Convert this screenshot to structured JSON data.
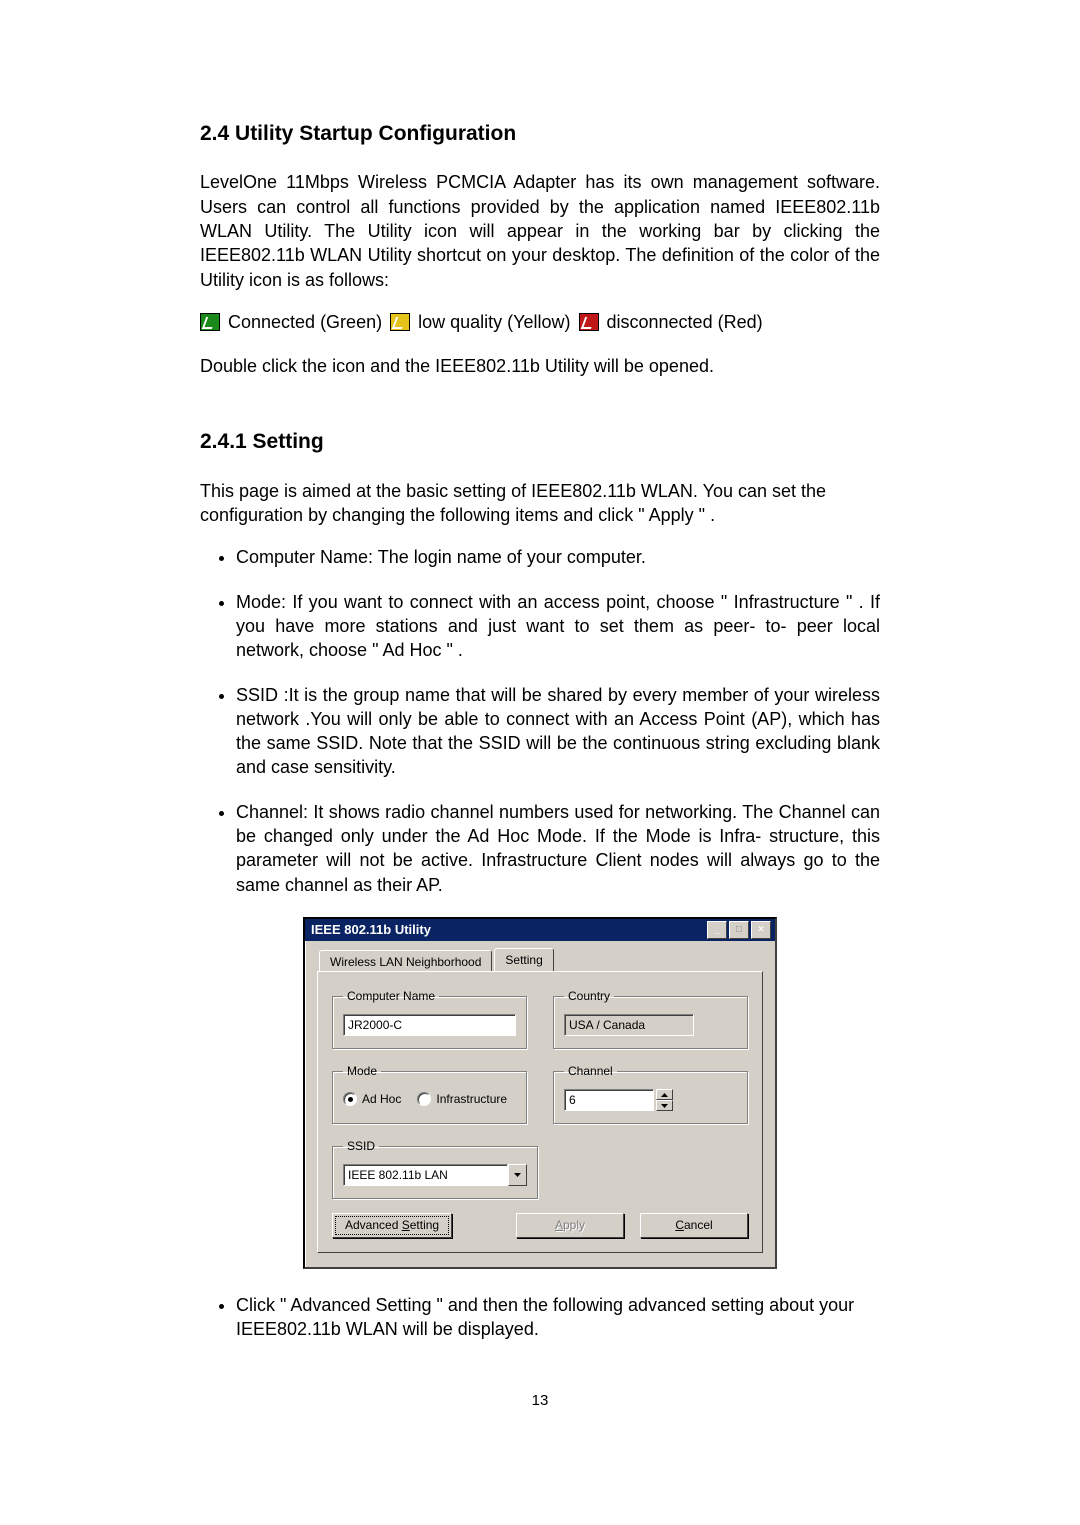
{
  "doc": {
    "h2": "2.4 Utility Startup Configuration",
    "p1": "LevelOne 11Mbps Wireless PCMCIA Adapter has its own management software. Users can control all functions provided by the application named IEEE802.11b WLAN Utility. The Utility icon will appear in the working bar by clicking the IEEE802.11b WLAN Utility shortcut on your desktop. The definition of the color of the Utility icon is as follows:",
    "status_connected": "Connected (Green)",
    "status_low": "low quality (Yellow)",
    "status_disc": "disconnected (Red)",
    "p2": "Double click the icon and the IEEE802.11b Utility will be opened.",
    "h3": "2.4.1 Setting",
    "p3": "This page is aimed at the basic setting of IEEE802.11b WLAN. You can set the configuration by changing the following items and click  \" Apply \" .",
    "li1": "Computer Name: The login name of your computer.",
    "li2": "Mode: If you want to connect with an access point, choose  \" Infrastructure \" . If you have more stations and just want to set them as peer- to- peer local network, choose \" Ad Hoc \" .",
    "li3": "SSID :It is the group name that will be shared by every member of your wireless network .You will only be able to connect with an Access Point (AP), which has the same SSID. Note that the SSID will be the continuous string excluding blank and case sensitivity.",
    "li4": "Channel: It shows radio channel numbers used for networking. The Channel can be changed only under the Ad Hoc Mode. If the Mode is  Infra- structure, this parameter will not be active. Infrastructure Client nodes will always go to the same channel as their AP.",
    "li5": "Click  \" Advanced Setting  \" and then the following advanced setting about your IEEE802.11b WLAN will be displayed.",
    "page_no": "13"
  },
  "dlg": {
    "title": "IEEE 802.11b Utility",
    "tab_neighborhood": "Wireless LAN Neighborhood",
    "tab_setting": "Setting",
    "grp_computer": "Computer Name",
    "grp_country": "Country",
    "grp_mode": "Mode",
    "grp_channel": "Channel",
    "grp_ssid": "SSID",
    "val_computer": "JR2000-C",
    "val_country": "USA / Canada",
    "val_mode_adhoc": "Ad Hoc",
    "val_mode_infra": "Infrastructure",
    "mode_selected": "adhoc",
    "val_channel": "6",
    "val_ssid": "IEEE 802.11b LAN",
    "btn_adv_pre": "Advanced ",
    "btn_adv_u": "S",
    "btn_adv_post": "etting",
    "btn_apply_u": "A",
    "btn_apply_post": "pply",
    "btn_cancel_u": "C",
    "btn_cancel_post": "ancel"
  }
}
